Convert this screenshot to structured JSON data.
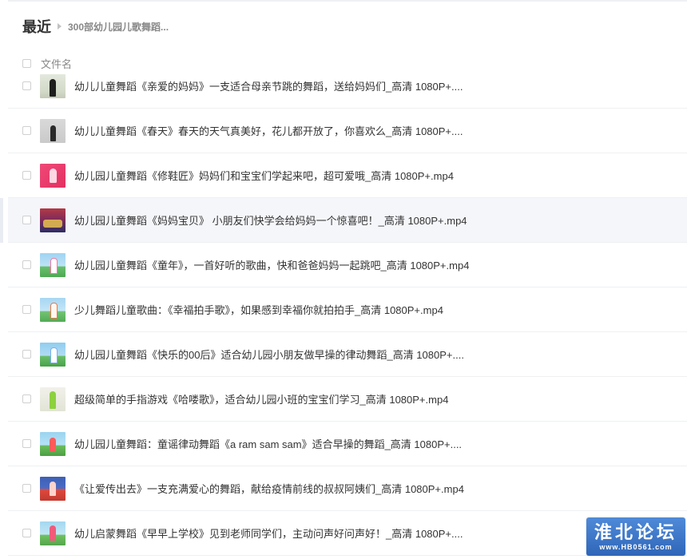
{
  "header": {
    "title": "最近",
    "breadcrumb": "300部幼儿园儿歌舞蹈..."
  },
  "list_header": {
    "column_name": "文件名"
  },
  "files": [
    {
      "name": "幼儿儿童舞蹈《亲爱的妈妈》一支适合母亲节跳的舞蹈，送给妈妈们_高清 1080P+....",
      "thumb": "dance-video-thumbnail"
    },
    {
      "name": "幼儿儿童舞蹈《春天》春天的天气真美好，花儿都开放了，你喜欢么_高清 1080P+....",
      "thumb": "dance-video-thumbnail"
    },
    {
      "name": "幼儿园儿童舞蹈《修鞋匠》妈妈们和宝宝们学起来吧，超可爱哦_高清 1080P+.mp4",
      "thumb": "dance-video-thumbnail"
    },
    {
      "name": "幼儿园儿童舞蹈《妈妈宝贝》 小朋友们快学会给妈妈一个惊喜吧！_高清 1080P+.mp4",
      "thumb": "dance-video-thumbnail"
    },
    {
      "name": "幼儿园儿童舞蹈《童年》，一首好听的歌曲，快和爸爸妈妈一起跳吧_高清 1080P+.mp4",
      "thumb": "dance-video-thumbnail"
    },
    {
      "name": "少儿舞蹈儿童歌曲：《幸福拍手歌》，如果感到幸福你就拍拍手_高清 1080P+.mp4",
      "thumb": "dance-video-thumbnail"
    },
    {
      "name": "幼儿园儿童舞蹈《快乐的00后》适合幼儿园小朋友做早操的律动舞蹈_高清 1080P+....",
      "thumb": "dance-video-thumbnail"
    },
    {
      "name": "超级简单的手指游戏《哈喽歌》，适合幼儿园小班的宝宝们学习_高清 1080P+.mp4",
      "thumb": "dance-video-thumbnail"
    },
    {
      "name": "幼儿园儿童舞蹈：童谣律动舞蹈《a ram sam sam》适合早操的舞蹈_高清 1080P+....",
      "thumb": "dance-video-thumbnail"
    },
    {
      "name": "《让爱传出去》一支充满爱心的舞蹈，献给疫情前线的叔叔阿姨们_高清 1080P+.mp4",
      "thumb": "dance-video-thumbnail"
    },
    {
      "name": "幼儿启蒙舞蹈《早早上学校》见到老师同学们，主动问声好问声好！_高清 1080P+....",
      "thumb": "dance-video-thumbnail"
    }
  ],
  "highlighted_index": 3,
  "watermark": {
    "title": "淮北论坛",
    "url": "www.HB0561.com"
  },
  "colors": {
    "text_primary": "#333333",
    "text_muted": "#888888",
    "divider": "#eef0f3",
    "hover_row": "#f5f6fa",
    "watermark_bg": "#3a74c6"
  }
}
